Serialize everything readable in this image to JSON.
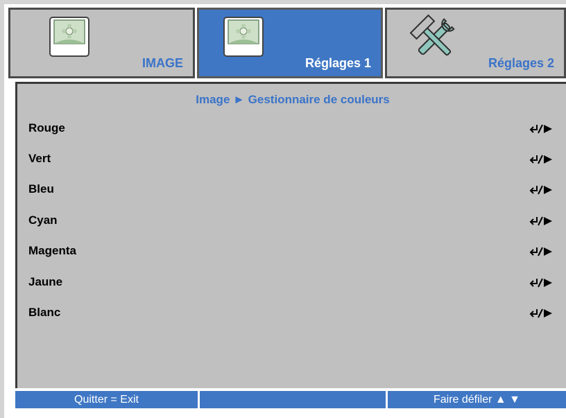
{
  "tabs": [
    {
      "label": "IMAGE",
      "icon": "picture-icon",
      "state": "inactive"
    },
    {
      "label": "Réglages 1",
      "icon": "picture-icon",
      "state": "active"
    },
    {
      "label": "Réglages 2",
      "icon": "tools-icon",
      "state": "inactive"
    }
  ],
  "breadcrumb": "Image ► Gestionnaire de couleurs",
  "menu_items": [
    {
      "label": "Rouge"
    },
    {
      "label": "Vert"
    },
    {
      "label": "Bleu"
    },
    {
      "label": "Cyan"
    },
    {
      "label": "Magenta"
    },
    {
      "label": "Jaune"
    },
    {
      "label": "Blanc"
    }
  ],
  "item_control_icon": "enter-or-right-arrow-icon",
  "footer": {
    "left": "Quitter = Exit",
    "middle": "",
    "right": "Faire défiler ▲ ▼"
  },
  "colors": {
    "accent_blue": "#3f77c4",
    "panel_gray": "#c0c0c0",
    "label_blue": "#3a73c9"
  }
}
